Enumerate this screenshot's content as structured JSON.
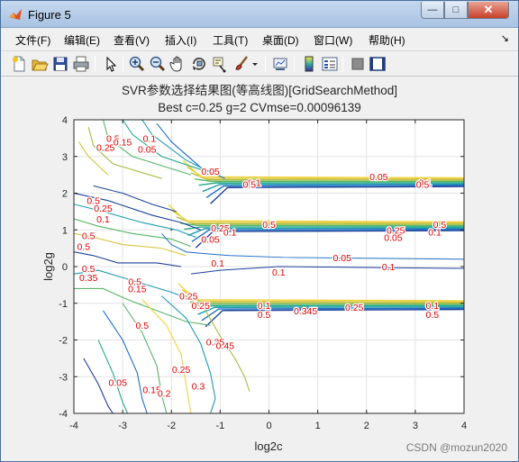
{
  "window": {
    "title": "Figure 5",
    "minimize_glyph": "—",
    "maximize_glyph": "□",
    "close_glyph": "✕"
  },
  "menu": [
    "文件(F)",
    "编辑(E)",
    "查看(V)",
    "插入(I)",
    "工具(T)",
    "桌面(D)",
    "窗口(W)",
    "帮助(H)"
  ],
  "menu_pin": "↘",
  "toolbar_icons": [
    "new-figure-icon",
    "open-file-icon",
    "save-icon",
    "print-icon",
    "select-arrow-icon",
    "zoom-in-icon",
    "zoom-out-icon",
    "pan-hand-icon",
    "rotate-3d-icon",
    "data-cursor-icon",
    "brush-icon",
    "brush-dropdown-icon",
    "link-plot-icon",
    "colorbar-icon",
    "legend-icon",
    "hide-plot-tools-icon",
    "show-plot-tools-icon"
  ],
  "figure": {
    "title_line1": "SVR参数选择结果图(等高线图)[GridSearchMethod]",
    "title_line2": "Best c=0.25 g=2 CVmse=0.00096139",
    "xlabel": "log2c",
    "ylabel": "log2g",
    "watermark": "CSDN @mozun2020"
  },
  "chart_data": {
    "type": "contour",
    "title": "SVR参数选择结果图(等高线图)[GridSearchMethod]",
    "subtitle": "Best c=0.25 g=2 CVmse=0.00096139",
    "xlabel": "log2c",
    "ylabel": "log2g",
    "xlim": [
      -4,
      4
    ],
    "ylim": [
      -4,
      4
    ],
    "xticks": [
      -4,
      -3,
      -2,
      -1,
      0,
      1,
      2,
      3,
      4
    ],
    "yticks": [
      -4,
      -3,
      -2,
      -1,
      0,
      1,
      2,
      3,
      4
    ],
    "grid": true,
    "best_point": {
      "log2c": -2,
      "log2g": 1
    },
    "colors": {
      "low": "#1f4e9c",
      "mid": "#2aa198",
      "high": "#f2d43a",
      "label": "#e00000"
    },
    "contour_bands": [
      {
        "center_log2g": 2.3,
        "x_from": -1.2,
        "x_to": 4
      },
      {
        "center_log2g": 1.1,
        "x_from": -1.5,
        "x_to": 4
      },
      {
        "center_log2g": -1.05,
        "x_from": -1.3,
        "x_to": 4
      }
    ],
    "level_labels": [
      {
        "x": -3.2,
        "y": 3.5,
        "text": "0.5"
      },
      {
        "x": -3.35,
        "y": 3.25,
        "text": "0.25"
      },
      {
        "x": -3.0,
        "y": 3.4,
        "text": "0.15"
      },
      {
        "x": -2.45,
        "y": 3.5,
        "text": "0.1"
      },
      {
        "x": -2.5,
        "y": 3.2,
        "text": "0.05"
      },
      {
        "x": -1.2,
        "y": 2.6,
        "text": "0.05"
      },
      {
        "x": -0.3,
        "y": 2.3,
        "text": "0.1"
      },
      {
        "x": -0.4,
        "y": 2.25,
        "text": "0.5"
      },
      {
        "x": 2.25,
        "y": 2.45,
        "text": "0.05"
      },
      {
        "x": 3.2,
        "y": 2.3,
        "text": "0.1"
      },
      {
        "x": 3.15,
        "y": 2.25,
        "text": "0.5"
      },
      {
        "x": -3.6,
        "y": 1.8,
        "text": "0.5"
      },
      {
        "x": -3.4,
        "y": 1.6,
        "text": "0.25"
      },
      {
        "x": -3.4,
        "y": 1.3,
        "text": "0.1"
      },
      {
        "x": -3.7,
        "y": 0.85,
        "text": "0.5"
      },
      {
        "x": -3.8,
        "y": 0.55,
        "text": "0.5"
      },
      {
        "x": -1.0,
        "y": 1.05,
        "text": "0.25"
      },
      {
        "x": -1.2,
        "y": 0.75,
        "text": "0.05"
      },
      {
        "x": -0.8,
        "y": 0.95,
        "text": "0.1"
      },
      {
        "x": 0.0,
        "y": 1.15,
        "text": "0.5"
      },
      {
        "x": 2.6,
        "y": 1.0,
        "text": "0.25"
      },
      {
        "x": 2.55,
        "y": 0.8,
        "text": "0.05"
      },
      {
        "x": 3.4,
        "y": 0.95,
        "text": "0.1"
      },
      {
        "x": 3.5,
        "y": 1.15,
        "text": "0.5"
      },
      {
        "x": 1.5,
        "y": 0.25,
        "text": "0.05"
      },
      {
        "x": -1.05,
        "y": 0.1,
        "text": "0.1"
      },
      {
        "x": 0.2,
        "y": -0.15,
        "text": "0.1"
      },
      {
        "x": 2.45,
        "y": 0.0,
        "text": "0.1"
      },
      {
        "x": -3.7,
        "y": -0.05,
        "text": "0.5"
      },
      {
        "x": -3.7,
        "y": -0.3,
        "text": "0.35"
      },
      {
        "x": -2.75,
        "y": -0.4,
        "text": "0.5"
      },
      {
        "x": -2.7,
        "y": -0.6,
        "text": "0.15"
      },
      {
        "x": -1.65,
        "y": -0.8,
        "text": "0.25"
      },
      {
        "x": -1.4,
        "y": -1.05,
        "text": "0.25"
      },
      {
        "x": -0.1,
        "y": -1.05,
        "text": "0.1"
      },
      {
        "x": -0.1,
        "y": -1.3,
        "text": "0.5"
      },
      {
        "x": 0.75,
        "y": -1.2,
        "text": "0.345"
      },
      {
        "x": 1.75,
        "y": -1.1,
        "text": "0.25"
      },
      {
        "x": 3.35,
        "y": -1.05,
        "text": "0.1"
      },
      {
        "x": 3.35,
        "y": -1.3,
        "text": "0.5"
      },
      {
        "x": -2.6,
        "y": -1.6,
        "text": "0.5"
      },
      {
        "x": -1.1,
        "y": -2.05,
        "text": "0.35"
      },
      {
        "x": -0.9,
        "y": -2.15,
        "text": "0.45"
      },
      {
        "x": -1.8,
        "y": -2.8,
        "text": "0.25"
      },
      {
        "x": -1.45,
        "y": -3.25,
        "text": "0.3"
      },
      {
        "x": -3.1,
        "y": -3.15,
        "text": "0.05"
      },
      {
        "x": -2.4,
        "y": -3.35,
        "text": "0.15"
      },
      {
        "x": -2.15,
        "y": -3.45,
        "text": "0.2"
      }
    ]
  }
}
